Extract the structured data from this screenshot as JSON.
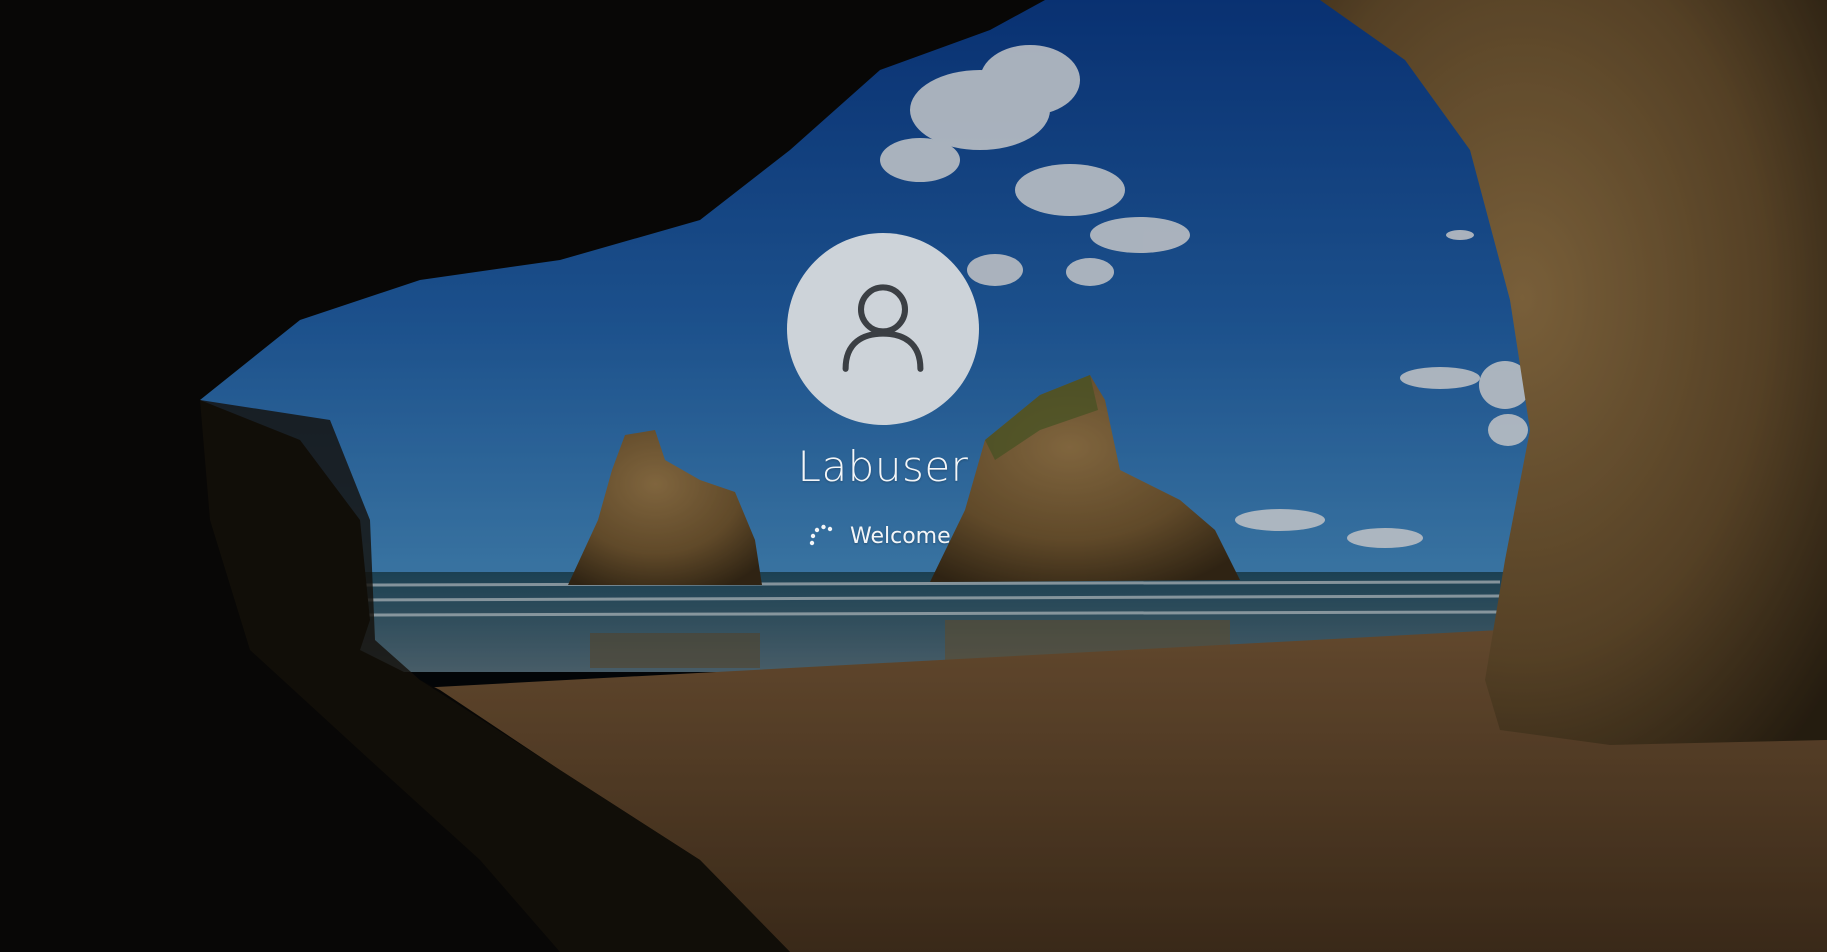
{
  "lock_screen": {
    "background_icon": "cave-beach-wallpaper",
    "overlay_dim": "rgba(0,0,0,0.22)"
  },
  "user": {
    "name": "Labuser",
    "avatar_icon": "user-icon",
    "avatar_background": "#cdd3d9",
    "avatar_icon_color": "#3b3f44"
  },
  "status": {
    "text": "Welcome",
    "spinner_icon": "loading-spinner-icon",
    "text_color": "#f4f6f8"
  },
  "colors": {
    "sky_top": "#0e3f8c",
    "sky_bottom": "#3c87c6",
    "sea": "#2b5c6c",
    "sand": "#7a5a37",
    "rock": "#8a6c3f",
    "cave": "#0b0a08"
  }
}
